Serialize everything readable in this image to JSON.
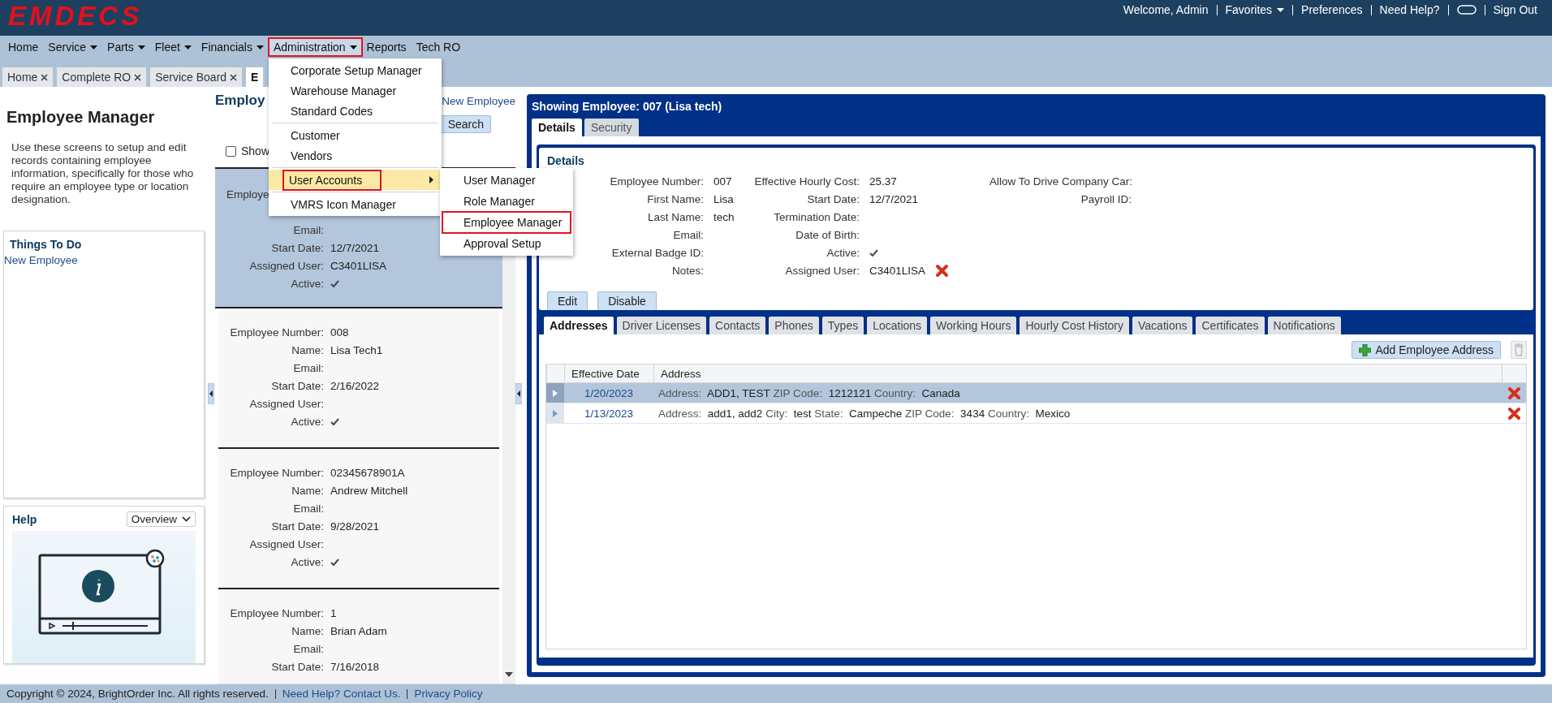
{
  "header": {
    "logo": "EMDECS",
    "links": [
      {
        "kind": "text",
        "label": "Welcome, Admin"
      },
      {
        "kind": "dropdown",
        "label": "Favorites"
      },
      {
        "kind": "link",
        "label": "Preferences"
      },
      {
        "kind": "link",
        "label": "Need Help?"
      },
      {
        "kind": "toggle"
      },
      {
        "kind": "link",
        "label": "Sign Out"
      }
    ]
  },
  "nav": [
    {
      "label": "Home",
      "has_menu": false,
      "open": false
    },
    {
      "label": "Service",
      "has_menu": true,
      "open": false
    },
    {
      "label": "Parts",
      "has_menu": true,
      "open": false
    },
    {
      "label": "Fleet",
      "has_menu": true,
      "open": false
    },
    {
      "label": "Financials",
      "has_menu": true,
      "open": false
    },
    {
      "label": "Administration",
      "has_menu": true,
      "open": true
    },
    {
      "label": "Reports",
      "has_menu": false,
      "open": false
    },
    {
      "label": "Tech RO",
      "has_menu": false,
      "open": false
    }
  ],
  "menu": {
    "groups": [
      [
        {
          "label": "Corporate Setup Manager",
          "hovered": false,
          "outlined": false,
          "has_submenu": false
        },
        {
          "label": "Warehouse Manager",
          "hovered": false,
          "outlined": false,
          "has_submenu": false
        },
        {
          "label": "Standard Codes",
          "hovered": false,
          "outlined": false,
          "has_submenu": false
        }
      ],
      [
        {
          "label": "Customer",
          "hovered": false,
          "outlined": false,
          "has_submenu": false
        },
        {
          "label": "Vendors",
          "hovered": false,
          "outlined": false,
          "has_submenu": false
        }
      ],
      [
        {
          "label": "User Accounts",
          "hovered": true,
          "outlined": true,
          "has_submenu": true
        }
      ],
      [
        {
          "label": "VMRS Icon Manager",
          "hovered": false,
          "outlined": false,
          "has_submenu": false
        }
      ]
    ],
    "submenu": [
      {
        "label": "User Manager",
        "outlined": false
      },
      {
        "label": "Role Manager",
        "outlined": false
      },
      {
        "label": "Employee Manager",
        "outlined": true
      },
      {
        "label": "Approval Setup",
        "outlined": false
      }
    ]
  },
  "tabs": [
    {
      "label": "Home",
      "selected": false,
      "closable": true
    },
    {
      "label": "Complete RO",
      "selected": false,
      "closable": true
    },
    {
      "label": "Service Board",
      "selected": false,
      "closable": true
    },
    {
      "label": "E",
      "selected": true,
      "closable": false
    }
  ],
  "left_panel": {
    "title": "Employee Manager",
    "description": "Use these screens to setup and edit records containing employee information, specifically for those who require an employee type or location designation.",
    "todo": {
      "title": "Things To Do",
      "links": [
        "New Employee"
      ]
    },
    "help": {
      "title": "Help",
      "select": "Overview"
    }
  },
  "employee_list": {
    "title": "Employ",
    "new_link": "New Employee",
    "search_button": "Search",
    "show_checkbox": {
      "label": "Show",
      "checked": false
    },
    "cards": [
      {
        "selected": true,
        "rows": [
          {
            "kind": "partial",
            "label": "Employe"
          },
          {
            "kind": "covered"
          },
          {
            "kind": "text",
            "label": "Email:"
          },
          {
            "kind": "text",
            "label": "Start Date:",
            "value": "12/7/2021"
          },
          {
            "kind": "text",
            "label": "Assigned User:",
            "value": "C3401LISA"
          },
          {
            "kind": "check",
            "label": "Active:",
            "checked": true
          }
        ]
      },
      {
        "selected": false,
        "rows": [
          {
            "kind": "text",
            "label": "Employee Number:",
            "value": "008"
          },
          {
            "kind": "text",
            "label": "Name:",
            "value": "Lisa Tech1"
          },
          {
            "kind": "text",
            "label": "Email:"
          },
          {
            "kind": "text",
            "label": "Start Date:",
            "value": "2/16/2022"
          },
          {
            "kind": "text",
            "label": "Assigned User:"
          },
          {
            "kind": "check",
            "label": "Active:",
            "checked": true
          }
        ]
      },
      {
        "selected": false,
        "rows": [
          {
            "kind": "text",
            "label": "Employee Number:",
            "value": "02345678901A"
          },
          {
            "kind": "text",
            "label": "Name:",
            "value": "Andrew Mitchell"
          },
          {
            "kind": "text",
            "label": "Email:"
          },
          {
            "kind": "text",
            "label": "Start Date:",
            "value": "9/28/2021"
          },
          {
            "kind": "text",
            "label": "Assigned User:"
          },
          {
            "kind": "check",
            "label": "Active:",
            "checked": true
          }
        ]
      },
      {
        "selected": false,
        "rows": [
          {
            "kind": "text",
            "label": "Employee Number:",
            "value": "1"
          },
          {
            "kind": "text",
            "label": "Name:",
            "value": "Brian Adam"
          },
          {
            "kind": "text",
            "label": "Email:"
          },
          {
            "kind": "text",
            "label": "Start Date:",
            "value": "7/16/2018"
          }
        ]
      }
    ]
  },
  "employee_detail": {
    "title": "Showing Employee: 007 (Lisa tech)",
    "tabs": [
      {
        "label": "Details",
        "selected": true
      },
      {
        "label": "Security",
        "selected": false
      }
    ],
    "section_title": "Details",
    "columns": [
      {
        "fields": [
          {
            "kind": "text",
            "label": "Employee Number:",
            "value": "007"
          },
          {
            "kind": "text",
            "label": "First Name:",
            "value": "Lisa"
          },
          {
            "kind": "text",
            "label": "Last Name:",
            "value": "tech"
          },
          {
            "kind": "text",
            "label": "Email:"
          },
          {
            "kind": "text",
            "label": "External Badge ID:"
          },
          {
            "kind": "text",
            "label": "Notes:"
          }
        ]
      },
      {
        "fields": [
          {
            "kind": "text",
            "label": "Effective Hourly Cost:",
            "value": "25.37"
          },
          {
            "kind": "text",
            "label": "Start Date:",
            "value": "12/7/2021"
          },
          {
            "kind": "text",
            "label": "Termination Date:"
          },
          {
            "kind": "text",
            "label": "Date of Birth:"
          },
          {
            "kind": "check",
            "label": "Active:",
            "checked": true
          },
          {
            "kind": "removable",
            "label": "Assigned User:",
            "value": "C3401LISA"
          }
        ]
      },
      {
        "fields": [
          {
            "kind": "text",
            "label": "Allow To Drive Company Car:"
          },
          {
            "kind": "text",
            "label": "Payroll ID:"
          }
        ]
      }
    ],
    "buttons": [
      "Edit",
      "Disable"
    ],
    "subtabs": [
      {
        "label": "Addresses",
        "selected": true
      },
      {
        "label": "Driver Licenses",
        "selected": false
      },
      {
        "label": "Contacts",
        "selected": false
      },
      {
        "label": "Phones",
        "selected": false
      },
      {
        "label": "Types",
        "selected": false
      },
      {
        "label": "Locations",
        "selected": false
      },
      {
        "label": "Working Hours",
        "selected": false
      },
      {
        "label": "Hourly Cost History",
        "selected": false
      },
      {
        "label": "Vacations",
        "selected": false
      },
      {
        "label": "Certificates",
        "selected": false
      },
      {
        "label": "Notifications",
        "selected": false
      }
    ],
    "add_button": "Add Employee Address",
    "table": {
      "columns": [
        "Effective Date",
        "Address"
      ],
      "rows": [
        {
          "selected": true,
          "date": "1/20/2023",
          "parts": [
            {
              "label": "Address:",
              "value": "ADD1, TEST"
            },
            {
              "label": "ZIP Code:",
              "value": "1212121"
            },
            {
              "label": "Country:",
              "value": "Canada"
            }
          ]
        },
        {
          "selected": false,
          "date": "1/13/2023",
          "parts": [
            {
              "label": "Address:",
              "value": "add1, add2"
            },
            {
              "label": "City:",
              "value": "test"
            },
            {
              "label": "State:",
              "value": "Campeche"
            },
            {
              "label": "ZIP Code:",
              "value": "3434"
            },
            {
              "label": "Country:",
              "value": "Mexico"
            }
          ]
        }
      ]
    }
  },
  "footer": {
    "copyright": "Copyright © 2024, BrightOrder Inc. All rights reserved.",
    "links": [
      "Need Help? Contact Us.",
      "Privacy Policy"
    ]
  }
}
